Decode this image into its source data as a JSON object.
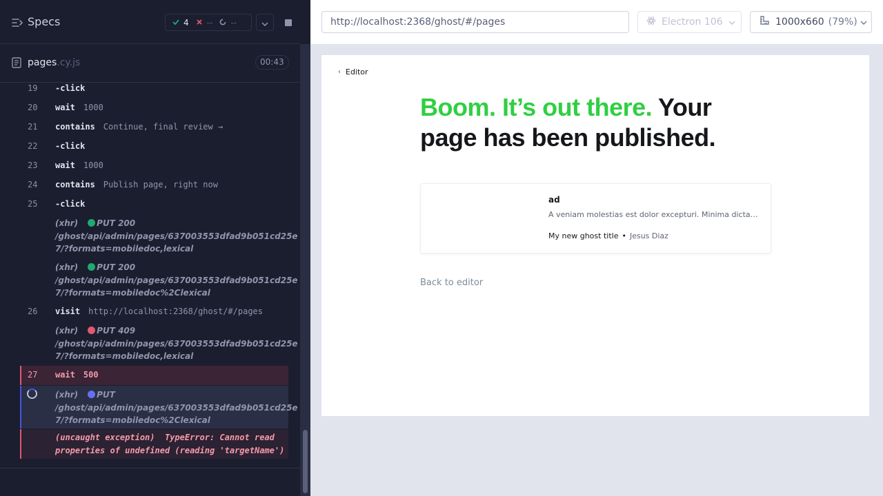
{
  "reporter": {
    "specs_title": "Specs",
    "stats": {
      "passed": "4",
      "failed": "--",
      "pending": "--"
    },
    "file": {
      "name": "pages",
      "ext": ".cy.js",
      "duration": "00:43"
    },
    "commands": [
      {
        "num": "19",
        "name": "-click",
        "msg": ""
      },
      {
        "num": "20",
        "name": "wait",
        "msg": "1000"
      },
      {
        "num": "21",
        "name": "contains",
        "msg": "Continue, final review →"
      },
      {
        "num": "22",
        "name": "-click",
        "msg": ""
      },
      {
        "num": "23",
        "name": "wait",
        "msg": "1000"
      },
      {
        "num": "24",
        "name": "contains",
        "msg": "Publish page, right now"
      },
      {
        "num": "25",
        "name": "-click",
        "msg": ""
      }
    ],
    "xhr1": {
      "label": "(xhr)",
      "status": "PUT 200",
      "line1": "/ghost/api/admin/pages/637003553dfad9b051cd25e",
      "line2": "7/?formats=mobiledoc,lexical"
    },
    "xhr2": {
      "label": "(xhr)",
      "status": "PUT 200",
      "line1": "/ghost/api/admin/pages/637003553dfad9b051cd25e",
      "line2": "7/?formats=mobiledoc%2Clexical"
    },
    "visit": {
      "num": "26",
      "name": "visit",
      "msg": "http://localhost:2368/ghost/#/pages"
    },
    "xhr3": {
      "label": "(xhr)",
      "status": "PUT 409",
      "line1": "/ghost/api/admin/pages/637003553dfad9b051cd25e",
      "line2": "7/?formats=mobiledoc,lexical"
    },
    "failed": {
      "num": "27",
      "name": "wait",
      "msg": "500"
    },
    "xhr4": {
      "label": "(xhr)",
      "status": "PUT",
      "line1": "/ghost/api/admin/pages/637003553dfad9b051cd25e",
      "line2": "7/?formats=mobiledoc%2Clexical"
    },
    "error": {
      "line1": "(uncaught exception)  TypeError: Cannot read",
      "line2": "properties of undefined (reading 'targetName')"
    }
  },
  "aut": {
    "url": "http://localhost:2368/ghost/#/pages",
    "browser": "Electron 106",
    "viewport_size": "1000x660",
    "viewport_scale": "(79%)",
    "page": {
      "back_crumb": "Editor",
      "headline_green": "Boom. It’s out there.",
      "headline_rest": " Your page has been published.",
      "bookmark": {
        "title": "ad",
        "description": "A veniam molestias est dolor excepturi. Minima dicta facere",
        "publisher": "My new ghost title",
        "separator": "•",
        "author": "Jesus Diaz"
      },
      "back_link": "Back to editor"
    }
  },
  "colors": {
    "pass": "#1fa971",
    "fail": "#e45770",
    "pending": "#6470f3",
    "headline_accent": "#30cf43"
  }
}
